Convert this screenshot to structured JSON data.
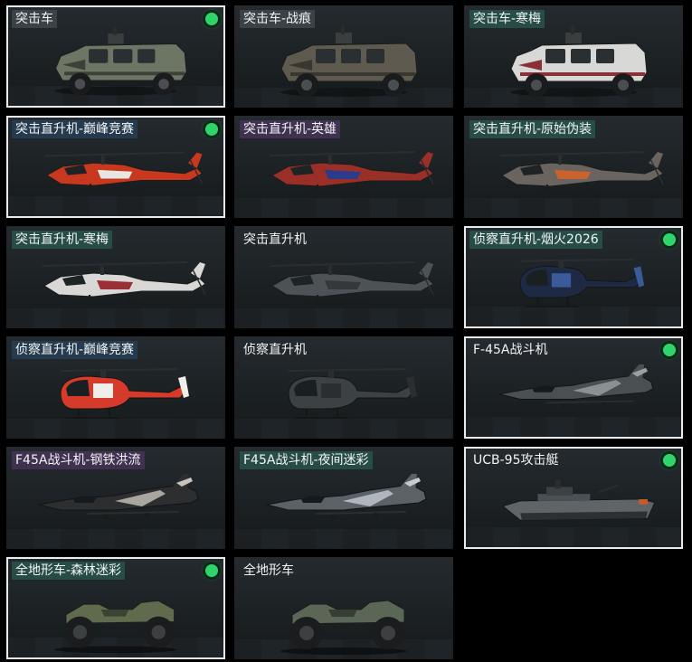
{
  "colors": {
    "equipped_dot": "#2fd46a",
    "selected_border": "#e9ecee",
    "card_bg": "#1c2124"
  },
  "vehicles": [
    {
      "name": "突击车",
      "type": "armored-car",
      "tint": "gray",
      "selected": true,
      "equipped": true,
      "skin": "#6d7565",
      "accent": "#3c4238"
    },
    {
      "name": "突击车-战痕",
      "type": "armored-car",
      "tint": "gray",
      "selected": false,
      "equipped": false,
      "skin": "#5e5a50",
      "accent": "#3a3630"
    },
    {
      "name": "突击车-寒梅",
      "type": "armored-car",
      "tint": "teal",
      "selected": false,
      "equipped": false,
      "skin": "#d8d8d6",
      "accent": "#8a3036"
    },
    {
      "name": "突击直升机-巅峰竞赛",
      "type": "attack-helicopter",
      "tint": "blue",
      "selected": true,
      "equipped": true,
      "skin": "#c8381f",
      "accent": "#e8e6e2"
    },
    {
      "name": "突击直升机-英雄",
      "type": "attack-helicopter",
      "tint": "purple",
      "selected": false,
      "equipped": false,
      "skin": "#9a2f28",
      "accent": "#2c3a8c"
    },
    {
      "name": "突击直升机-原始伪装",
      "type": "attack-helicopter",
      "tint": "teal",
      "selected": false,
      "equipped": false,
      "skin": "#6a6460",
      "accent": "#c9622c"
    },
    {
      "name": "突击直升机-寒梅",
      "type": "attack-helicopter",
      "tint": "teal",
      "selected": false,
      "equipped": false,
      "skin": "#dad8d6",
      "accent": "#9a2f38"
    },
    {
      "name": "突击直升机",
      "type": "attack-helicopter",
      "tint": "none",
      "selected": false,
      "equipped": false,
      "skin": "#4d5256",
      "accent": "#34383b"
    },
    {
      "name": "侦察直升机-烟火2026",
      "type": "scout-helicopter",
      "tint": "teal",
      "selected": true,
      "equipped": true,
      "skin": "#1e2a44",
      "accent": "#3a5a9a"
    },
    {
      "name": "侦察直升机-巅峰竞赛",
      "type": "scout-helicopter",
      "tint": "blue",
      "selected": false,
      "equipped": false,
      "skin": "#d63a2a",
      "accent": "#f0eeea"
    },
    {
      "name": "侦察直升机",
      "type": "scout-helicopter",
      "tint": "none",
      "selected": false,
      "equipped": false,
      "skin": "#3c4144",
      "accent": "#2a2e31"
    },
    {
      "name": "F-45A战斗机",
      "type": "fighter-jet",
      "tint": "none",
      "selected": true,
      "equipped": true,
      "skin": "#4a4f52",
      "accent": "#9aa0a4"
    },
    {
      "name": "F45A战斗机-钢铁洪流",
      "type": "fighter-jet",
      "tint": "purple",
      "selected": false,
      "equipped": false,
      "skin": "#2c2e30",
      "accent": "#c8c4bc"
    },
    {
      "name": "F45A战斗机-夜间迷彩",
      "type": "fighter-jet",
      "tint": "teal",
      "selected": false,
      "equipped": false,
      "skin": "#5a6268",
      "accent": "#c5ccd2"
    },
    {
      "name": "UCB-95攻击艇",
      "type": "attack-boat",
      "tint": "none",
      "selected": true,
      "equipped": true,
      "skin": "#5e6468",
      "accent": "#c75a2a"
    },
    {
      "name": "全地形车-森林迷彩",
      "type": "atv",
      "tint": "teal",
      "selected": true,
      "equipped": true,
      "skin": "#5f6b4c",
      "accent": "#3a4232"
    },
    {
      "name": "全地形车",
      "type": "atv",
      "tint": "none",
      "selected": false,
      "equipped": false,
      "skin": "#5a6656",
      "accent": "#363d34"
    }
  ]
}
